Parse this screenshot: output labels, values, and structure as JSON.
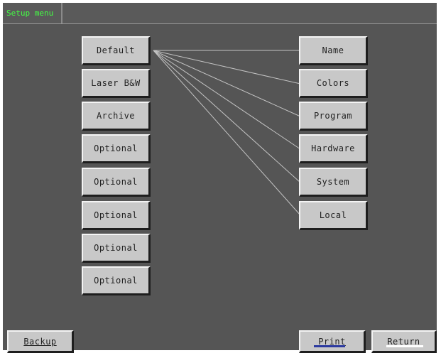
{
  "header": {
    "title": "Setup menu"
  },
  "left_buttons": [
    {
      "label": "Default"
    },
    {
      "label": "Laser B&W"
    },
    {
      "label": "Archive"
    },
    {
      "label": "Optional"
    },
    {
      "label": "Optional"
    },
    {
      "label": "Optional"
    },
    {
      "label": "Optional"
    },
    {
      "label": "Optional"
    }
  ],
  "right_buttons": [
    {
      "label": "Name"
    },
    {
      "label": "Colors"
    },
    {
      "label": "Program"
    },
    {
      "label": "Hardware"
    },
    {
      "label": "System"
    },
    {
      "label": "Local"
    }
  ],
  "footer": {
    "backup_label": "Backup",
    "print_label": "Print",
    "return_label": "Return"
  },
  "colors": {
    "background": "#555555",
    "button_face": "#c8c8c8",
    "title_text": "#44ff44",
    "print_accent": "#2c3aa0",
    "return_accent": "#ffffff"
  }
}
